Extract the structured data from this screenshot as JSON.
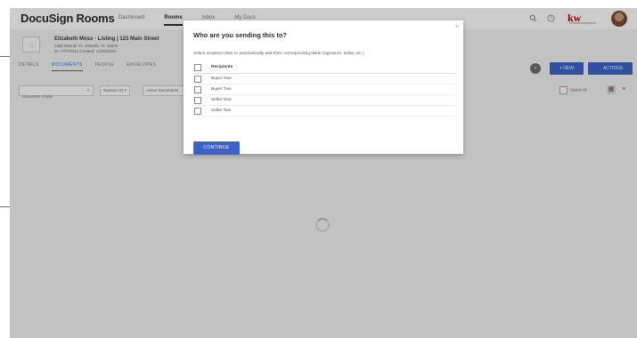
{
  "app": {
    "logo": "DocuSign Rooms"
  },
  "nav": {
    "items": [
      "Dashboard",
      "Rooms",
      "Inbox",
      "My Docs"
    ],
    "active_index": 1
  },
  "topbar_icons": [
    "search-icon",
    "help-icon"
  ],
  "brand": {
    "kw": "kw"
  },
  "listing": {
    "title": "Elizabeth Moss - Listing | 123 Main Street",
    "address": "3482 Banner Ct. Orlando, FL 32832",
    "meta": "ID: #7073014   Created: 11/05/2022"
  },
  "tabs": {
    "items": [
      "DETAILS",
      "DOCUMENTS",
      "PEOPLE",
      "ENVELOPES"
    ],
    "active_index": 1
  },
  "actions": {
    "new_label": "+ NEW",
    "actions_label": "⋮ ACTIONS"
  },
  "filters": {
    "search_placeholder": "Document Finder",
    "sort_label": "Name(A-Z) ▾",
    "active_filter": "Active Documents",
    "select_all": "Select All"
  },
  "modal": {
    "title": "Who are you sending this to?",
    "description": "Select recipient roles to automatically add their corresponding fields (signature, initial, etc.)",
    "header": "Recipients",
    "recipients": [
      "Buyer One",
      "Buyer Two",
      "Seller One",
      "Seller Two"
    ],
    "continue_label": "CONTINUE",
    "close_symbol": "×"
  },
  "colors": {
    "accent": "#3d63c9",
    "kw_red": "#b40101"
  }
}
